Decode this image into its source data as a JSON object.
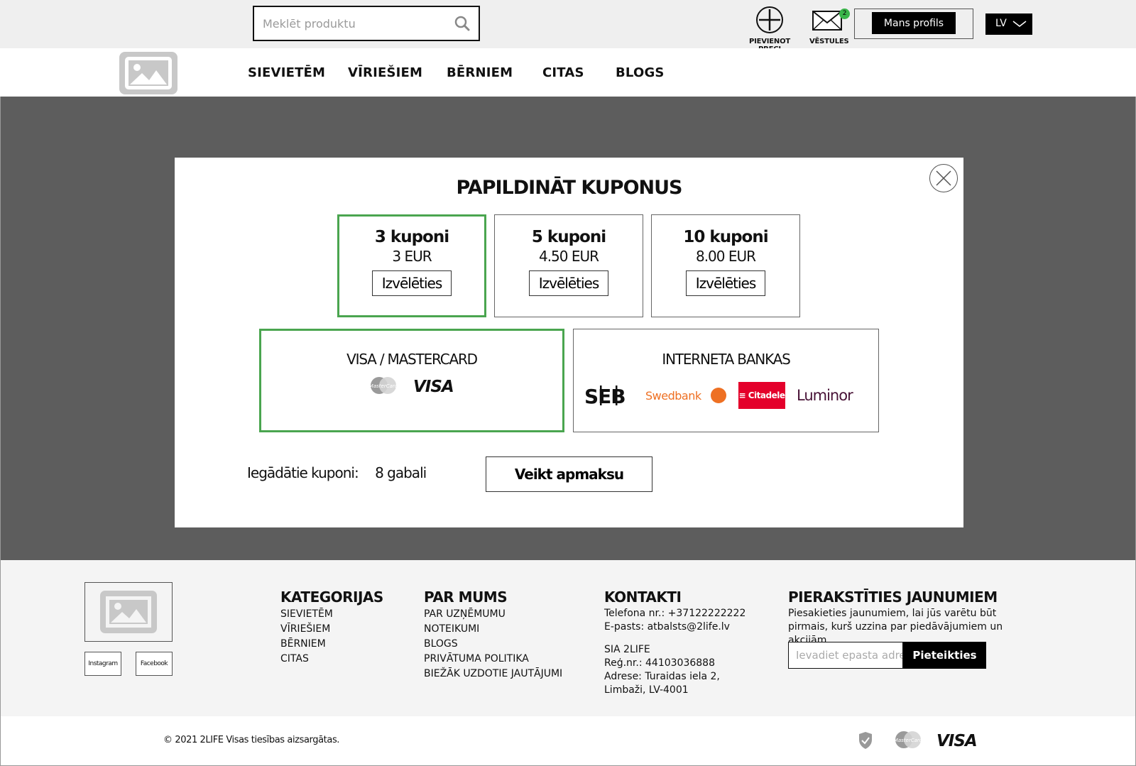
{
  "search": {
    "placeholder": "Meklēt produktu"
  },
  "header_actions": {
    "add_product_label": "PIEVIENOT PRECI",
    "messages_label": "VĒSTULES",
    "messages_count": "2",
    "profile_label": "Mans profils",
    "language": "LV"
  },
  "nav": [
    "SIEVIETĒM",
    "VĪRIEŠIEM",
    "BĒRNIEM",
    "CITAS",
    "BLOGS"
  ],
  "modal": {
    "title": "PAPILDINĀT KUPONUS",
    "packages": [
      {
        "qty": "3 kuponi",
        "price": "3 EUR",
        "button": "Izvēlēties",
        "selected": true
      },
      {
        "qty": "5 kuponi",
        "price": "4.50 EUR",
        "button": "Izvēlēties",
        "selected": false
      },
      {
        "qty": "10 kuponi",
        "price": "8.00 EUR",
        "button": "Izvēlēties",
        "selected": false
      }
    ],
    "payment_methods": {
      "card": {
        "title": "VISA / MASTERCARD",
        "selected": true,
        "logos": [
          "MasterCard",
          "VISA"
        ]
      },
      "bank": {
        "title": "INTERNETA BANKAS",
        "selected": false,
        "logos": [
          "SEB",
          "Swedbank",
          "Citadele",
          "Luminor"
        ]
      }
    },
    "bought_label": "Iegādātie kuponi:",
    "bought_value": "8 gabali",
    "pay_button": "Veikt apmaksu"
  },
  "footer": {
    "social": [
      "Instagram",
      "Facebook"
    ],
    "categories": {
      "title": "KATEGORIJAS",
      "items": [
        "SIEVIETĒM",
        "VĪRIEŠIEM",
        "BĒRNIEM",
        "CITAS"
      ]
    },
    "about": {
      "title": "PAR MUMS",
      "items": [
        "PAR UZŅĒMUMU",
        "NOTEIKUMI",
        "BLOGS",
        "PRIVĀTUMA POLITIKA",
        "BIEŽĀK UZDOTIE JAUTĀJUMI"
      ]
    },
    "contacts": {
      "title": "KONTAKTI",
      "phone": "Telefona nr.: +37122222222",
      "email": "E-pasts:  atbalsts@2life.lv",
      "company": "SIA 2LIFE",
      "reg": "Reģ.nr.: 44103036888",
      "address1": "Adrese: Turaidas iela 2,",
      "address2": "Limbaži, LV-4001"
    },
    "newsletter": {
      "title": "PIERAKSTĪTIES JAUNUMIEM",
      "text": "Piesakieties jaunumiem, lai jūs varētu būt pirmais, kurš uzzina par piedāvājumiem un akcijām.",
      "placeholder": "Ievadiet epasta adresi",
      "button": "Pieteikties"
    },
    "copyright": "© 2021 2LIFE Visas tiesības aizsargātas.",
    "payment_logos": [
      "MasterCard",
      "VISA"
    ]
  },
  "colors": {
    "accent_green": "#4aa54f",
    "overlay": "#5d5d5d",
    "citadele_red": "#e4002b",
    "swedbank_orange": "#ee7023",
    "luminor_purple": "#481236"
  }
}
